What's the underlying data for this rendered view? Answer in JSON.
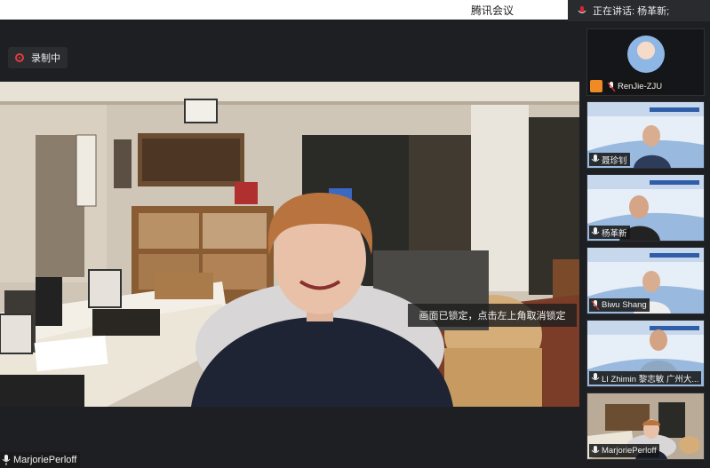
{
  "app": {
    "title": "腾讯会议"
  },
  "speaking": {
    "label": "正在讲话: 杨革新;"
  },
  "recording": {
    "label": "录制中"
  },
  "main_video": {
    "lock_notice": "画面已锁定，点击左上角取消锁定",
    "participant_name": "MarjoriePerloff"
  },
  "participants": [
    {
      "name": "RenJie-ZJU"
    },
    {
      "name": "聂珍钊"
    },
    {
      "name": "杨革新"
    },
    {
      "name": "Biwu Shang"
    },
    {
      "name": "LI Zhimin 黎志敏 广州大..."
    },
    {
      "name": "MarjoriePerloff"
    }
  ],
  "colors": {
    "recording": "#e03c3c",
    "accent": "#f08a22"
  }
}
